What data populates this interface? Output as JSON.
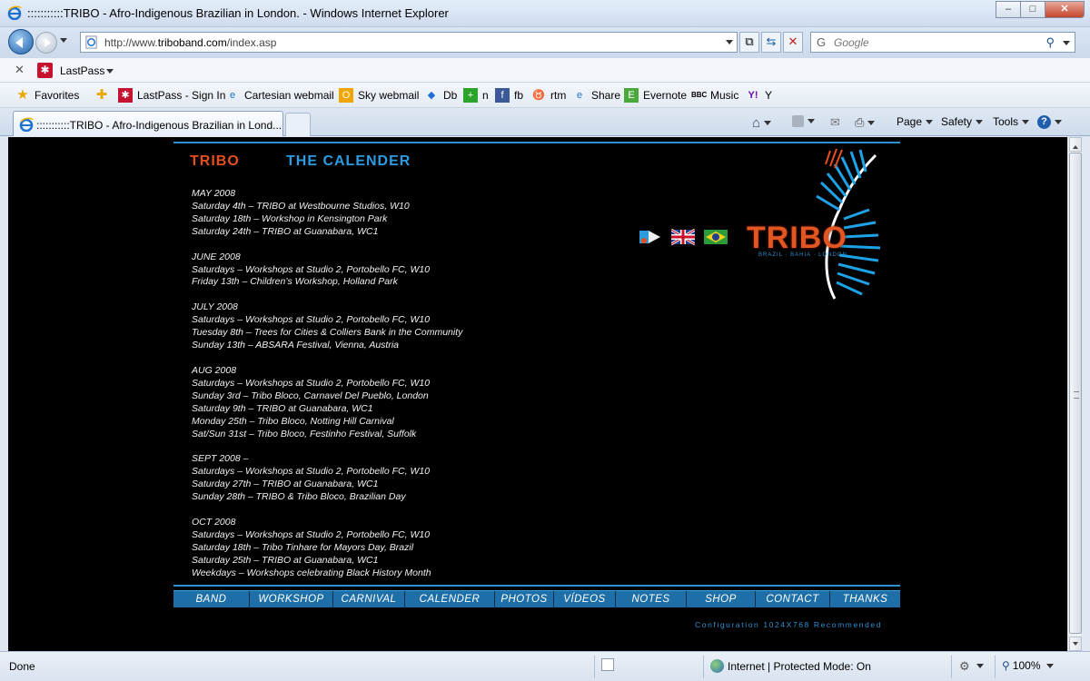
{
  "window": {
    "title": ":::::::::::TRIBO - Afro-Indigenous Brazilian in London. - Windows Internet Explorer",
    "minimize": "–",
    "maximize": "□",
    "close": "✕"
  },
  "nav": {
    "url_prefix": "http://www.",
    "url_domain": "triboband.com",
    "url_suffix": "/index.asp",
    "search_placeholder": "Google",
    "search_engine_icon": "G"
  },
  "lastpass_bar": {
    "close_glyph": "✕",
    "label": "LastPass"
  },
  "favorites": {
    "label": "Favorites",
    "items": [
      {
        "label": "LastPass - Sign In",
        "icon": "lastpass-icon"
      },
      {
        "label": "Cartesian webmail",
        "icon": "ie-page-icon"
      },
      {
        "label": "Sky webmail",
        "icon": "outlook-icon"
      },
      {
        "label": "Db",
        "icon": "dropbox-icon"
      },
      {
        "label": "n",
        "icon": "plus-icon"
      },
      {
        "label": "fb",
        "icon": "facebook-icon"
      },
      {
        "label": "rtm",
        "icon": "cow-icon"
      },
      {
        "label": "Share",
        "icon": "ie-page-icon"
      },
      {
        "label": "Evernote",
        "icon": "evernote-icon"
      },
      {
        "label": "Music",
        "icon": "bbc-icon"
      },
      {
        "label": "Y",
        "icon": "yahoo-icon"
      }
    ]
  },
  "tabs": [
    {
      "label": ":::::::::::TRIBO - Afro-Indigenous Brazilian in Lond..."
    }
  ],
  "command_bar": {
    "page": "Page",
    "safety": "Safety",
    "tools": "Tools",
    "help": "?"
  },
  "page": {
    "heading_left": "TRIBO",
    "heading_right": "THE CALENDER",
    "logo_text": "TRIBO",
    "logo_sub": "BRAZIL · BAHIA · LONDON",
    "months": [
      {
        "title": "MAY 2008",
        "events": [
          "Saturday 4th –   TRIBO at Westbourne Studios, W10",
          "Saturday 18th – Workshop in Kensington Park",
          "Saturday 24th – TRIBO at Guanabara, WC1"
        ]
      },
      {
        "title": "JUNE 2008",
        "events": [
          "Saturdays   – Workshops at Studio 2, Portobello FC, W10",
          "Friday 13th – Children’s Workshop, Holland Park"
        ]
      },
      {
        "title": "JULY 2008",
        "events": [
          "Saturdays  –   Workshops at Studio 2, Portobello FC, W10",
          "Tuesday 8th – Trees for Cities & Colliers Bank in the Community",
          "Sunday 13th – ABSARA Festival, Vienna, Austria"
        ]
      },
      {
        "title": "AUG 2008",
        "events": [
          "Saturdays –    Workshops at Studio 2, Portobello FC, W10",
          "Sunday 3rd –   Tribo Bloco, Carnavel Del Pueblo, London",
          "Saturday 9th – TRIBO at Guanabara, WC1",
          "Monday 25th – Tribo Bloco, Notting Hill Carnival",
          "Sat/Sun 31st – Tribo Bloco, Festinho Festival, Suffolk"
        ]
      },
      {
        "title": "SEPT 2008 –",
        "events": [
          "Saturdays –   Workshops at Studio 2, Portobello FC, W10",
          "Saturday 27th – TRIBO at Guanabara, WC1",
          "Sunday 28th – TRIBO & Tribo Bloco, Brazilian Day"
        ]
      },
      {
        "title": "OCT 2008",
        "events": [
          "Saturdays –   Workshops at Studio 2, Portobello FC, W10",
          "Saturday 18th – Tribo Tinhare for Mayors Day, Brazil",
          "Saturday 25th – TRIBO at Guanabara, WC1",
          "Weekdays –  Workshops celebrating Black History Month"
        ]
      }
    ],
    "menu": [
      "BAND",
      "WORKSHOP",
      "CARNIVAL",
      "CALENDER",
      "PHOTOS",
      "VÍDEOS",
      "NOTES",
      "SHOP",
      "CONTACT",
      "THANKS"
    ],
    "config_note": "Configuration 1024X768 Recommended"
  },
  "status": {
    "text": "Done",
    "zone": "Internet | Protected Mode: On",
    "zoom": "100%"
  },
  "colors": {
    "accent_blue": "#2d9be0",
    "tribo_orange": "#e4501d",
    "menu_blue": "#1e6fa8"
  }
}
